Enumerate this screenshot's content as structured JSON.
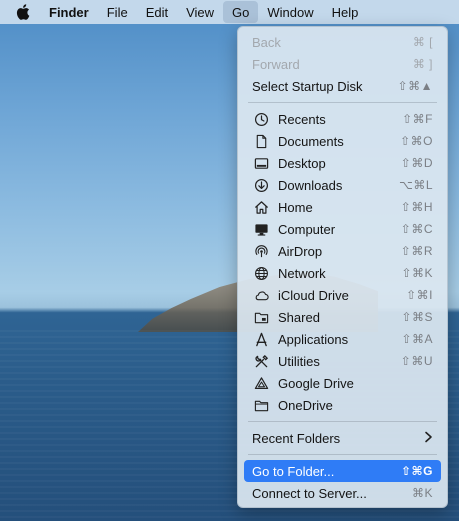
{
  "menubar": {
    "apple_icon": "apple-logo",
    "items": [
      "Finder",
      "File",
      "Edit",
      "View",
      "Go",
      "Window",
      "Help"
    ],
    "active": "Go"
  },
  "go_menu": {
    "top": [
      {
        "label": "Back",
        "shortcut": "⌘ [",
        "disabled": true
      },
      {
        "label": "Forward",
        "shortcut": "⌘ ]",
        "disabled": true
      },
      {
        "label": "Select Startup Disk",
        "shortcut": "⇧⌘▲",
        "disabled": false
      }
    ],
    "places": [
      {
        "label": "Recents",
        "shortcut": "⇧⌘F",
        "icon": "clock-icon"
      },
      {
        "label": "Documents",
        "shortcut": "⇧⌘O",
        "icon": "document-icon"
      },
      {
        "label": "Desktop",
        "shortcut": "⇧⌘D",
        "icon": "desktop-icon"
      },
      {
        "label": "Downloads",
        "shortcut": "⌥⌘L",
        "icon": "download-icon"
      },
      {
        "label": "Home",
        "shortcut": "⇧⌘H",
        "icon": "home-icon"
      },
      {
        "label": "Computer",
        "shortcut": "⇧⌘C",
        "icon": "computer-icon"
      },
      {
        "label": "AirDrop",
        "shortcut": "⇧⌘R",
        "icon": "airdrop-icon"
      },
      {
        "label": "Network",
        "shortcut": "⇧⌘K",
        "icon": "globe-icon"
      },
      {
        "label": "iCloud Drive",
        "shortcut": "⇧⌘I",
        "icon": "cloud-icon"
      },
      {
        "label": "Shared",
        "shortcut": "⇧⌘S",
        "icon": "shared-folder-icon"
      },
      {
        "label": "Applications",
        "shortcut": "⇧⌘A",
        "icon": "applications-icon"
      },
      {
        "label": "Utilities",
        "shortcut": "⇧⌘U",
        "icon": "utilities-icon"
      },
      {
        "label": "Google Drive",
        "shortcut": "",
        "icon": "google-drive-icon"
      },
      {
        "label": "OneDrive",
        "shortcut": "",
        "icon": "folder-icon"
      }
    ],
    "recent_folders": {
      "label": "Recent Folders",
      "icon": "chevron-right-icon"
    },
    "go_to_folder": {
      "label": "Go to Folder...",
      "shortcut": "⇧⌘G"
    },
    "connect_server": {
      "label": "Connect to Server...",
      "shortcut": "⌘K"
    }
  },
  "colors": {
    "highlight": "#2f7cf6",
    "menu_bg": "#dae6f0",
    "menubar_bg": "#cddeee"
  }
}
